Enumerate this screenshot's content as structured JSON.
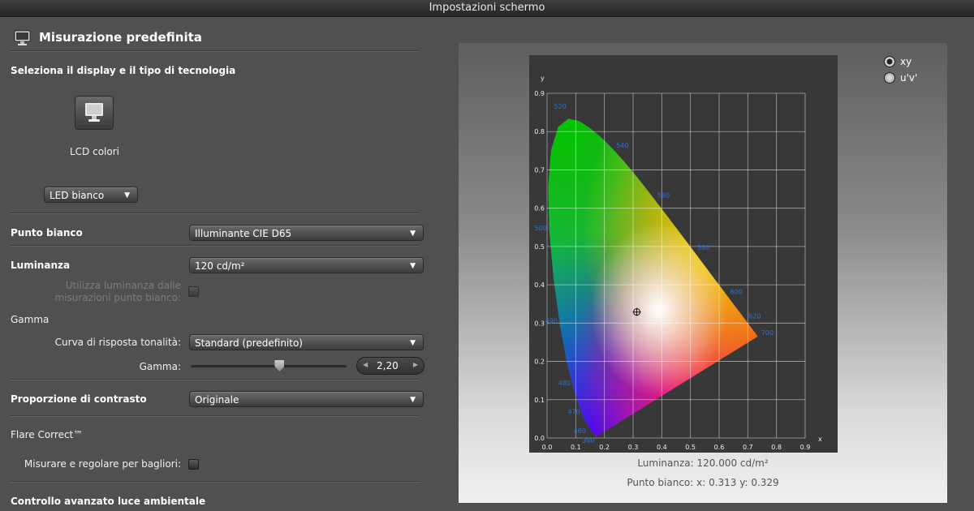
{
  "window": {
    "title": "Impostazioni schermo"
  },
  "header": {
    "title": "Misurazione predefinita",
    "icon": "display-icon"
  },
  "display_section": {
    "title": "Seleziona il display e il tipo di tecnologia",
    "display_name": "LCD colori",
    "technology": "LED bianco"
  },
  "white_point": {
    "label": "Punto bianco",
    "value": "Illuminante CIE D65"
  },
  "luminance": {
    "label": "Luminanza",
    "value": "120 cd/m²",
    "use_from_whitepoint_label_1": "Utilizza luminanza dalle",
    "use_from_whitepoint_label_2": "misurazioni punto bianco:"
  },
  "gamma": {
    "title": "Gamma",
    "tone_curve_label": "Curva di risposta tonalità:",
    "tone_curve_value": "Standard (predefinito)",
    "gamma_label": "Gamma:",
    "gamma_value": "2,20",
    "slider_fraction": 0.57
  },
  "contrast": {
    "label": "Proporzione di contrasto",
    "value": "Originale"
  },
  "flare": {
    "title": "Flare Correct™",
    "measure_label": "Misurare e regolare per bagliori:"
  },
  "ambient": {
    "title": "Controllo avanzato luce ambientale"
  },
  "chart_toggle": {
    "xy_label": "xy",
    "uv_label": "u'v'",
    "selected": "xy"
  },
  "chart_info": {
    "luminance_text": "Luminanza: 120.000 cd/m²",
    "whitepoint_text": "Punto bianco: x: 0.313  y: 0.329"
  },
  "chart_data": {
    "type": "scatter",
    "xlabel": "x",
    "ylabel": "y",
    "xlim": [
      0,
      0.9
    ],
    "ylim": [
      0,
      0.9
    ],
    "grid": true,
    "x_ticks": [
      "0.0",
      "0.1",
      "0.2",
      "0.3",
      "0.4",
      "0.5",
      "0.6",
      "0.7",
      "0.8",
      "0.9"
    ],
    "y_ticks": [
      "0.0",
      "0.1",
      "0.2",
      "0.3",
      "0.4",
      "0.5",
      "0.6",
      "0.7",
      "0.8",
      "0.9"
    ],
    "wavelength_labels": [
      {
        "text": "380",
        "x": 0.174,
        "y": 0.005
      },
      {
        "text": "460",
        "x": 0.144,
        "y": 0.03
      },
      {
        "text": "470",
        "x": 0.124,
        "y": 0.058
      },
      {
        "text": "480",
        "x": 0.091,
        "y": 0.133
      },
      {
        "text": "490",
        "x": 0.045,
        "y": 0.295
      },
      {
        "text": "500",
        "x": 0.008,
        "y": 0.538
      },
      {
        "text": "520",
        "x": 0.074,
        "y": 0.834
      },
      {
        "text": "540",
        "x": 0.23,
        "y": 0.754
      },
      {
        "text": "560",
        "x": 0.373,
        "y": 0.624
      },
      {
        "text": "580",
        "x": 0.512,
        "y": 0.487
      },
      {
        "text": "600",
        "x": 0.627,
        "y": 0.372
      },
      {
        "text": "620",
        "x": 0.691,
        "y": 0.308
      },
      {
        "text": "700",
        "x": 0.735,
        "y": 0.265
      }
    ],
    "locus": [
      [
        0.1741,
        0.005
      ],
      [
        0.1738,
        0.0049
      ],
      [
        0.1721,
        0.0048
      ],
      [
        0.1689,
        0.0069
      ],
      [
        0.1644,
        0.0109
      ],
      [
        0.1566,
        0.0177
      ],
      [
        0.144,
        0.0297
      ],
      [
        0.1241,
        0.0578
      ],
      [
        0.0913,
        0.1327
      ],
      [
        0.0687,
        0.2007
      ],
      [
        0.0454,
        0.295
      ],
      [
        0.0235,
        0.4127
      ],
      [
        0.0082,
        0.5384
      ],
      [
        0.0039,
        0.6548
      ],
      [
        0.0139,
        0.7502
      ],
      [
        0.0389,
        0.812
      ],
      [
        0.0743,
        0.8338
      ],
      [
        0.1142,
        0.8262
      ],
      [
        0.1547,
        0.8059
      ],
      [
        0.1929,
        0.7816
      ],
      [
        0.2296,
        0.7543
      ],
      [
        0.2658,
        0.7243
      ],
      [
        0.3016,
        0.6923
      ],
      [
        0.3373,
        0.6589
      ],
      [
        0.3731,
        0.6245
      ],
      [
        0.4087,
        0.5896
      ],
      [
        0.4441,
        0.5547
      ],
      [
        0.4788,
        0.5202
      ],
      [
        0.5125,
        0.4866
      ],
      [
        0.5448,
        0.4544
      ],
      [
        0.5752,
        0.4242
      ],
      [
        0.6029,
        0.3965
      ],
      [
        0.627,
        0.3725
      ],
      [
        0.6482,
        0.3514
      ],
      [
        0.6658,
        0.334
      ],
      [
        0.6801,
        0.3197
      ],
      [
        0.6915,
        0.3083
      ],
      [
        0.7006,
        0.2993
      ],
      [
        0.7079,
        0.292
      ],
      [
        0.714,
        0.2859
      ],
      [
        0.719,
        0.2809
      ],
      [
        0.723,
        0.277
      ],
      [
        0.726,
        0.274
      ],
      [
        0.7283,
        0.2717
      ],
      [
        0.73,
        0.27
      ],
      [
        0.7347,
        0.2653
      ]
    ],
    "white_point": {
      "x": 0.313,
      "y": 0.329
    }
  }
}
